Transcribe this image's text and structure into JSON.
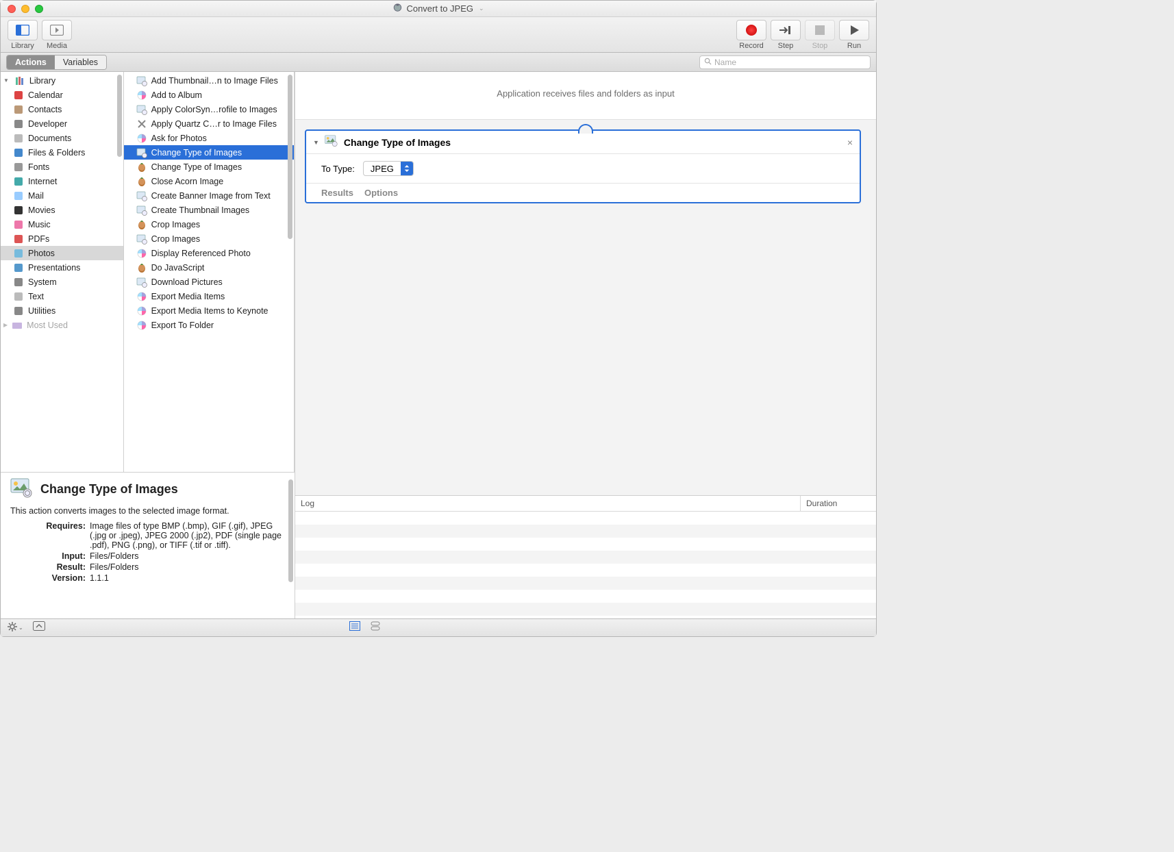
{
  "window": {
    "title": "Convert to JPEG"
  },
  "toolbar": {
    "library": "Library",
    "media": "Media",
    "record": "Record",
    "step": "Step",
    "stop": "Stop",
    "run": "Run"
  },
  "tabs": {
    "actions": "Actions",
    "variables": "Variables"
  },
  "search": {
    "placeholder": "Name"
  },
  "library": {
    "root": "Library",
    "items": [
      "Calendar",
      "Contacts",
      "Developer",
      "Documents",
      "Files & Folders",
      "Fonts",
      "Internet",
      "Mail",
      "Movies",
      "Music",
      "PDFs",
      "Photos",
      "Presentations",
      "System",
      "Text",
      "Utilities"
    ],
    "selected": "Photos",
    "trailing": "Most Used"
  },
  "actions": {
    "items": [
      "Add Thumbnail…n to Image Files",
      "Add to Album",
      "Apply ColorSyn…rofile to Images",
      "Apply Quartz C…r to Image Files",
      "Ask for Photos",
      "Change Type of Images",
      "Change Type of Images",
      "Close Acorn Image",
      "Create Banner Image from Text",
      "Create Thumbnail Images",
      "Crop Images",
      "Crop Images",
      "Display Referenced Photo",
      "Do JavaScript",
      "Download Pictures",
      "Export Media Items",
      "Export Media Items to Keynote",
      "Export To Folder"
    ],
    "selected_index": 5
  },
  "info": {
    "title": "Change Type of Images",
    "description": "This action converts images to the selected image format.",
    "requires": "Image files of type BMP (.bmp), GIF (.gif), JPEG (.jpg or .jpeg), JPEG 2000 (.jp2), PDF (single page .pdf), PNG (.png), or TIFF (.tif or .tiff).",
    "input": "Files/Folders",
    "result": "Files/Folders",
    "version": "1.1.1",
    "labels": {
      "requires": "Requires:",
      "input": "Input:",
      "result": "Result:",
      "version": "Version:"
    }
  },
  "workflow": {
    "input_message": "Application receives files and folders as input",
    "action": {
      "title": "Change Type of Images",
      "param_label": "To Type:",
      "param_value": "JPEG",
      "results": "Results",
      "options": "Options"
    }
  },
  "log": {
    "col1": "Log",
    "col2": "Duration"
  }
}
